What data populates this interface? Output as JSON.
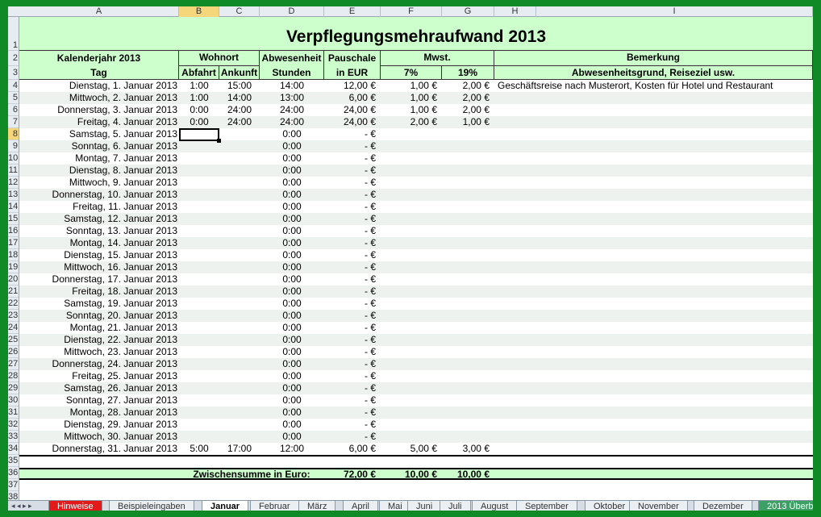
{
  "column_headers": [
    "A",
    "B",
    "C",
    "D",
    "E",
    "F",
    "G",
    "H",
    "I"
  ],
  "row_numbers": [
    "1",
    "2",
    "3",
    "4",
    "5",
    "6",
    "7",
    "8",
    "9",
    "10",
    "11",
    "12",
    "13",
    "14",
    "15",
    "16",
    "17",
    "18",
    "19",
    "20",
    "21",
    "22",
    "23",
    "24",
    "25",
    "26",
    "27",
    "28",
    "29",
    "30",
    "31",
    "32",
    "33",
    "34",
    "35",
    "36",
    "37",
    "38"
  ],
  "title": "Verpflegungsmehraufwand 2013",
  "headers": {
    "kalenderjahr": "Kalenderjahr 2013",
    "tag": "Tag",
    "wohnort": "Wohnort",
    "abfahrt": "Abfahrt",
    "ankunft": "Ankunft",
    "abwesenheit": "Abwesenheit",
    "stunden": "Stunden",
    "pauschale": "Pauschale",
    "in_eur": "in EUR",
    "mwst": "Mwst.",
    "mwst7": "7%",
    "mwst19": "19%",
    "bemerkung": "Bemerkung",
    "abwesenheitsgrund": "Abwesenheitsgrund, Reiseziel usw."
  },
  "rows": [
    {
      "day": "Dienstag, 1. Januar 2013",
      "abfahrt": "1:00",
      "ankunft": "15:00",
      "stunden": "14:00",
      "pauschale": "12,00 €",
      "m7": "1,00 €",
      "m19": "2,00 €",
      "note": "Geschäftsreise nach Musterort, Kosten für Hotel und Restaurant"
    },
    {
      "day": "Mittwoch, 2. Januar 2013",
      "abfahrt": "1:00",
      "ankunft": "14:00",
      "stunden": "13:00",
      "pauschale": "6,00 €",
      "m7": "1,00 €",
      "m19": "2,00 €",
      "note": ""
    },
    {
      "day": "Donnerstag, 3. Januar 2013",
      "abfahrt": "0:00",
      "ankunft": "24:00",
      "stunden": "24:00",
      "pauschale": "24,00 €",
      "m7": "1,00 €",
      "m19": "2,00 €",
      "note": ""
    },
    {
      "day": "Freitag, 4. Januar 2013",
      "abfahrt": "0:00",
      "ankunft": "24:00",
      "stunden": "24:00",
      "pauschale": "24,00 €",
      "m7": "2,00 €",
      "m19": "1,00 €",
      "note": ""
    },
    {
      "day": "Samstag, 5. Januar 2013",
      "abfahrt": "",
      "ankunft": "",
      "stunden": "0:00",
      "pauschale": "-   €",
      "m7": "",
      "m19": "",
      "note": ""
    },
    {
      "day": "Sonntag, 6. Januar 2013",
      "abfahrt": "",
      "ankunft": "",
      "stunden": "0:00",
      "pauschale": "-   €",
      "m7": "",
      "m19": "",
      "note": ""
    },
    {
      "day": "Montag, 7. Januar 2013",
      "abfahrt": "",
      "ankunft": "",
      "stunden": "0:00",
      "pauschale": "-   €",
      "m7": "",
      "m19": "",
      "note": ""
    },
    {
      "day": "Dienstag, 8. Januar 2013",
      "abfahrt": "",
      "ankunft": "",
      "stunden": "0:00",
      "pauschale": "-   €",
      "m7": "",
      "m19": "",
      "note": ""
    },
    {
      "day": "Mittwoch, 9. Januar 2013",
      "abfahrt": "",
      "ankunft": "",
      "stunden": "0:00",
      "pauschale": "-   €",
      "m7": "",
      "m19": "",
      "note": ""
    },
    {
      "day": "Donnerstag, 10. Januar 2013",
      "abfahrt": "",
      "ankunft": "",
      "stunden": "0:00",
      "pauschale": "-   €",
      "m7": "",
      "m19": "",
      "note": ""
    },
    {
      "day": "Freitag, 11. Januar 2013",
      "abfahrt": "",
      "ankunft": "",
      "stunden": "0:00",
      "pauschale": "-   €",
      "m7": "",
      "m19": "",
      "note": ""
    },
    {
      "day": "Samstag, 12. Januar 2013",
      "abfahrt": "",
      "ankunft": "",
      "stunden": "0:00",
      "pauschale": "-   €",
      "m7": "",
      "m19": "",
      "note": ""
    },
    {
      "day": "Sonntag, 13. Januar 2013",
      "abfahrt": "",
      "ankunft": "",
      "stunden": "0:00",
      "pauschale": "-   €",
      "m7": "",
      "m19": "",
      "note": ""
    },
    {
      "day": "Montag, 14. Januar 2013",
      "abfahrt": "",
      "ankunft": "",
      "stunden": "0:00",
      "pauschale": "-   €",
      "m7": "",
      "m19": "",
      "note": ""
    },
    {
      "day": "Dienstag, 15. Januar 2013",
      "abfahrt": "",
      "ankunft": "",
      "stunden": "0:00",
      "pauschale": "-   €",
      "m7": "",
      "m19": "",
      "note": ""
    },
    {
      "day": "Mittwoch, 16. Januar 2013",
      "abfahrt": "",
      "ankunft": "",
      "stunden": "0:00",
      "pauschale": "-   €",
      "m7": "",
      "m19": "",
      "note": ""
    },
    {
      "day": "Donnerstag, 17. Januar 2013",
      "abfahrt": "",
      "ankunft": "",
      "stunden": "0:00",
      "pauschale": "-   €",
      "m7": "",
      "m19": "",
      "note": ""
    },
    {
      "day": "Freitag, 18. Januar 2013",
      "abfahrt": "",
      "ankunft": "",
      "stunden": "0:00",
      "pauschale": "-   €",
      "m7": "",
      "m19": "",
      "note": ""
    },
    {
      "day": "Samstag, 19. Januar 2013",
      "abfahrt": "",
      "ankunft": "",
      "stunden": "0:00",
      "pauschale": "-   €",
      "m7": "",
      "m19": "",
      "note": ""
    },
    {
      "day": "Sonntag, 20. Januar 2013",
      "abfahrt": "",
      "ankunft": "",
      "stunden": "0:00",
      "pauschale": "-   €",
      "m7": "",
      "m19": "",
      "note": ""
    },
    {
      "day": "Montag, 21. Januar 2013",
      "abfahrt": "",
      "ankunft": "",
      "stunden": "0:00",
      "pauschale": "-   €",
      "m7": "",
      "m19": "",
      "note": ""
    },
    {
      "day": "Dienstag, 22. Januar 2013",
      "abfahrt": "",
      "ankunft": "",
      "stunden": "0:00",
      "pauschale": "-   €",
      "m7": "",
      "m19": "",
      "note": ""
    },
    {
      "day": "Mittwoch, 23. Januar 2013",
      "abfahrt": "",
      "ankunft": "",
      "stunden": "0:00",
      "pauschale": "-   €",
      "m7": "",
      "m19": "",
      "note": ""
    },
    {
      "day": "Donnerstag, 24. Januar 2013",
      "abfahrt": "",
      "ankunft": "",
      "stunden": "0:00",
      "pauschale": "-   €",
      "m7": "",
      "m19": "",
      "note": ""
    },
    {
      "day": "Freitag, 25. Januar 2013",
      "abfahrt": "",
      "ankunft": "",
      "stunden": "0:00",
      "pauschale": "-   €",
      "m7": "",
      "m19": "",
      "note": ""
    },
    {
      "day": "Samstag, 26. Januar 2013",
      "abfahrt": "",
      "ankunft": "",
      "stunden": "0:00",
      "pauschale": "-   €",
      "m7": "",
      "m19": "",
      "note": ""
    },
    {
      "day": "Sonntag, 27. Januar 2013",
      "abfahrt": "",
      "ankunft": "",
      "stunden": "0:00",
      "pauschale": "-   €",
      "m7": "",
      "m19": "",
      "note": ""
    },
    {
      "day": "Montag, 28. Januar 2013",
      "abfahrt": "",
      "ankunft": "",
      "stunden": "0:00",
      "pauschale": "-   €",
      "m7": "",
      "m19": "",
      "note": ""
    },
    {
      "day": "Dienstag, 29. Januar 2013",
      "abfahrt": "",
      "ankunft": "",
      "stunden": "0:00",
      "pauschale": "-   €",
      "m7": "",
      "m19": "",
      "note": ""
    },
    {
      "day": "Mittwoch, 30. Januar 2013",
      "abfahrt": "",
      "ankunft": "",
      "stunden": "0:00",
      "pauschale": "-   €",
      "m7": "",
      "m19": "",
      "note": ""
    },
    {
      "day": "Donnerstag, 31. Januar 2013",
      "abfahrt": "5:00",
      "ankunft": "17:00",
      "stunden": "12:00",
      "pauschale": "6,00 €",
      "m7": "5,00 €",
      "m19": "3,00 €",
      "note": ""
    }
  ],
  "subtotal": {
    "label": "Zwischensumme in Euro:",
    "pauschale": "72,00 €",
    "m7": "10,00 €",
    "m19": "10,00 €"
  },
  "tabs": [
    "Hinweise",
    "Beispieleingaben",
    "Januar",
    "Februar",
    "März",
    "April",
    "Mai",
    "Juni",
    "Juli",
    "August",
    "September",
    "Oktober",
    "November",
    "Dezember",
    "2013 Überb"
  ],
  "tab_nav": "◂ ◂ ▸ ▸",
  "colors": {
    "frame": "#0f8a26",
    "header_fill": "#ccffcc",
    "band": "#eef2ee",
    "tab_red": "#e21a1a",
    "tab_green": "#3aa063"
  }
}
